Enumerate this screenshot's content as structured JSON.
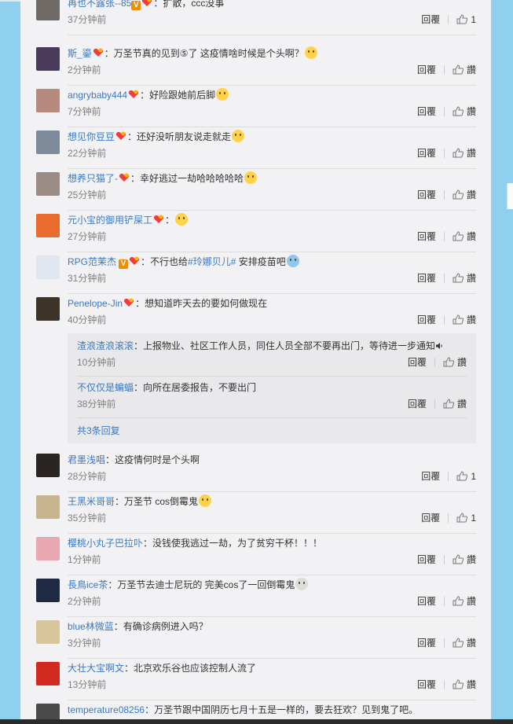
{
  "actions": {
    "reply": "回覆",
    "like_text": "讚"
  },
  "comments": [
    {
      "name": "再也不露张--85",
      "text": "：扩散，ccc没事",
      "time": "37分钟前",
      "likes": "1",
      "avatar": "#6f6a66",
      "v": true
    },
    {
      "name": "斯_鎏",
      "text": "：万圣节真的见到⑤了 这疫情啥时候是个头啊？",
      "time": "2分钟前",
      "likes": "",
      "avatar": "#4a3b5a"
    },
    {
      "name": "angrybaby444",
      "text": "：好险跟她前后脚",
      "time": "7分钟前",
      "likes": "",
      "avatar": "#b58a7c"
    },
    {
      "name": "想见你豆豆",
      "text": "：还好没听朋友说走就走",
      "time": "22分钟前",
      "likes": "",
      "avatar": "#7d8a9a"
    },
    {
      "name": "想养只猫了-",
      "text": "：幸好逃过一劫哈哈哈哈哈",
      "time": "25分钟前",
      "likes": "",
      "avatar": "#9c8c86"
    },
    {
      "name": "元小宝的御用铲屎工",
      "text": "：",
      "time": "27分钟前",
      "likes": "",
      "avatar": "#e96b2e"
    },
    {
      "name": "RPG范茉杰",
      "text_pre": "：不行也给",
      "hashtag": "#玲娜贝儿#",
      "text_post": " 安排疫苗吧",
      "time": "31分钟前",
      "likes": "",
      "avatar": "#e0e6f0",
      "v": true
    },
    {
      "name": "Penelope-Jin",
      "text": "：想知道昨天去的要如何做现在",
      "time": "40分钟前",
      "likes": "",
      "avatar": "#3e3328"
    },
    {
      "name": "君墨浅唱",
      "text": "：这疫情何时是个头啊",
      "time": "28分钟前",
      "likes": "1",
      "avatar": "#2a2422"
    },
    {
      "name": "王黑米哥哥",
      "text": "：万圣节 cos倒霉鬼",
      "time": "35分钟前",
      "likes": "1",
      "avatar": "#c8b58e"
    },
    {
      "name": "樱桃小丸子巴拉卟",
      "text": "：没钱使我逃过一劫，为了贫穷干杯！！！",
      "time": "1分钟前",
      "likes": "",
      "avatar": "#e9a7b2"
    },
    {
      "name": "長鳥ice茶",
      "text": "：万圣节去迪士尼玩的 完美cos了一回倒霉鬼",
      "time": "2分钟前",
      "likes": "",
      "avatar": "#1f2a44"
    },
    {
      "name": "blue林微蓝",
      "text": "：有确诊病例进入吗？",
      "time": "3分钟前",
      "likes": "",
      "avatar": "#d9c59a"
    },
    {
      "name": "大壮大宝啊文",
      "text": "：北京欢乐谷也应该控制人流了",
      "time": "13分钟前",
      "likes": "",
      "avatar": "#d22a1e"
    },
    {
      "name": "temperature08256",
      "text": "：万圣节跟中国阴历七月十五是一样的，要去狂欢？见到鬼了吧。",
      "time": "",
      "likes": "",
      "avatar": "#4a4a4a"
    }
  ],
  "replies": [
    {
      "name": "渣浪渣浪滚滚",
      "text": "：上报物业、社区工作人员，同住人员全部不要再出门，等待进一步通知",
      "time": "10分钟前"
    },
    {
      "name": "不仅仅是蝙蝠",
      "text": "：向所在居委报告，不要出门",
      "time": "38分钟前"
    }
  ],
  "more_replies": "共3条回复"
}
